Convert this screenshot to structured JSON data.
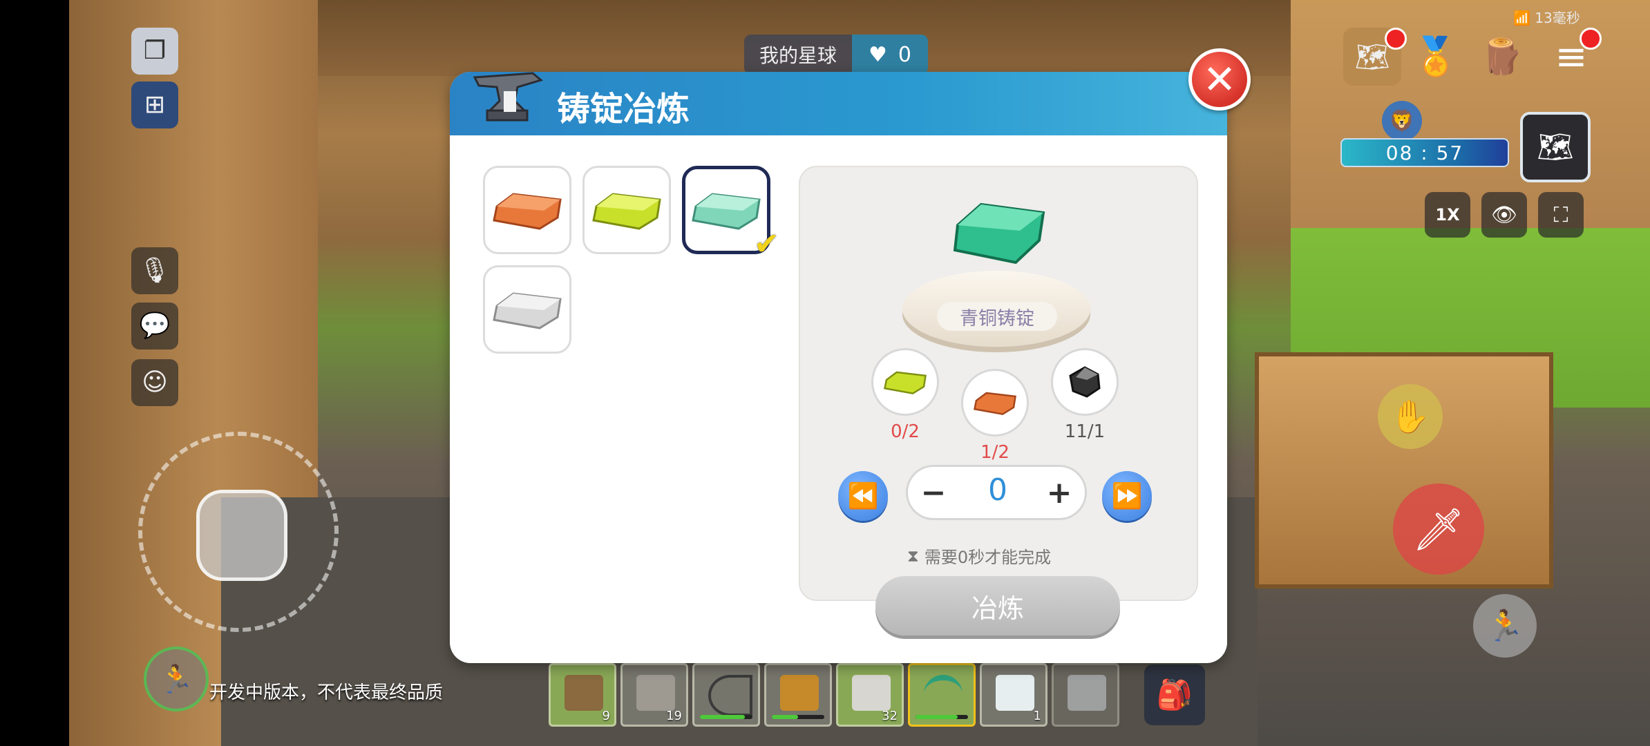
{
  "hud": {
    "planet_label": "我的星球",
    "planet_count": "0",
    "network_latency": "13毫秒",
    "timer": "08 : 57",
    "zoom_label": "1X",
    "dev_note": "开发中版本，不代表最终品质"
  },
  "dialog": {
    "title": "铸锭冶炼",
    "close_symbol": "✕",
    "recipes": [
      {
        "name": "copper-ingot",
        "color": "#e8783a"
      },
      {
        "name": "sulfur-ingot",
        "color": "#c9e02a"
      },
      {
        "name": "bronze-ingot",
        "color": "#7fd6b8",
        "selected": true
      },
      {
        "name": "silver-ingot",
        "color": "#d8d8d8"
      }
    ],
    "product_name": "青铜铸锭",
    "product_color": "#2fbf8f",
    "ingredients": [
      {
        "count": "0/2",
        "color": "#c9e02a",
        "count_color": "#e24a4a"
      },
      {
        "count": "1/2",
        "color": "#e8783a",
        "count_color": "#e24a4a"
      },
      {
        "count": "11/1",
        "color": "#333333",
        "count_color": "#555555"
      }
    ],
    "quantity": "0",
    "minus": "−",
    "plus": "+",
    "time_note": "需要0秒才能完成",
    "smelt_label": "冶炼"
  },
  "hotbar": [
    {
      "item": "rail",
      "count": "9"
    },
    {
      "item": "stone-stairs",
      "count": "19"
    },
    {
      "item": "bow",
      "durability": 0.85
    },
    {
      "item": "axe",
      "durability": 0.5
    },
    {
      "item": "stone-block",
      "count": "32"
    },
    {
      "item": "pickaxe",
      "durability": 0.8
    },
    {
      "item": "glass",
      "count": "1"
    },
    {
      "item": "empty-block",
      "count": ""
    }
  ]
}
